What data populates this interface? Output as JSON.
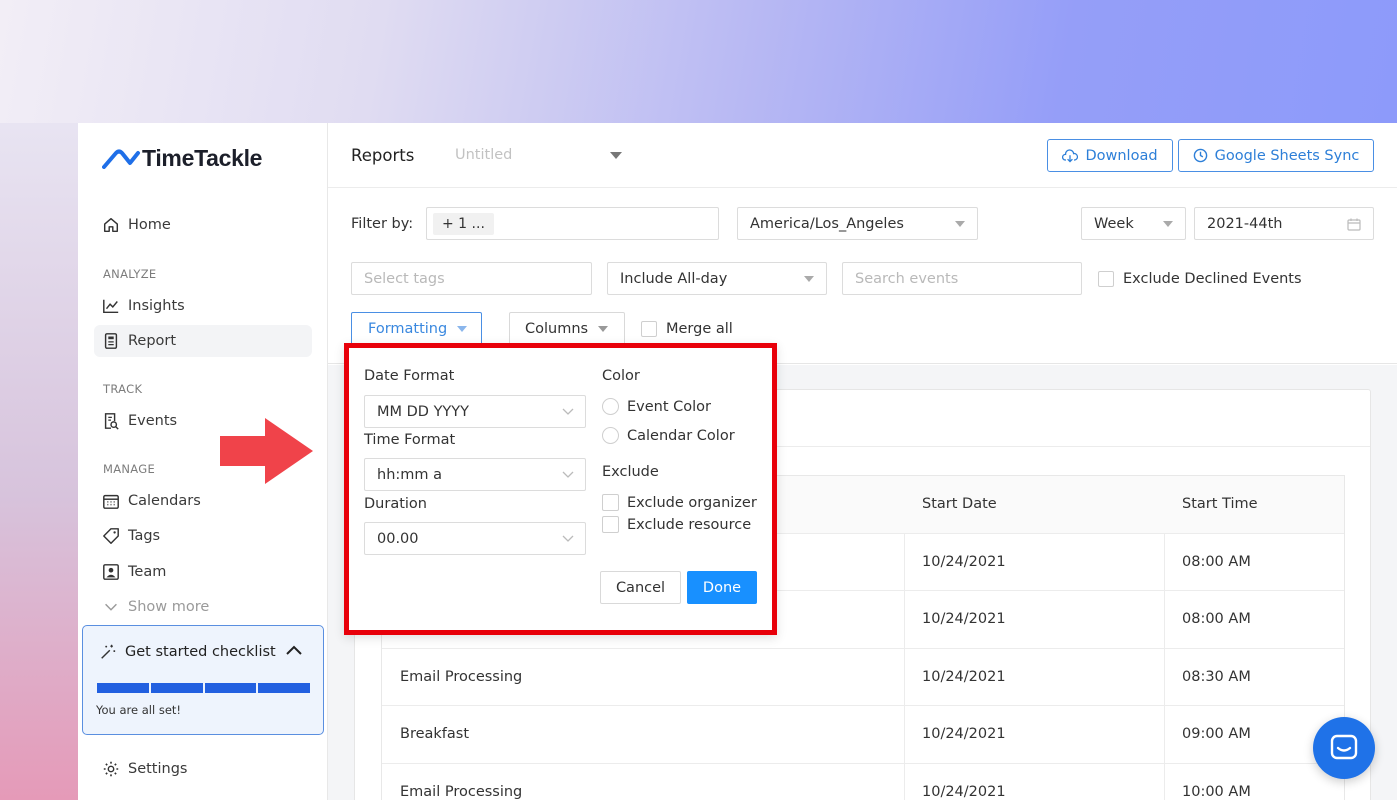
{
  "app": {
    "logo_text": "TimeTackle"
  },
  "sidebar": {
    "home": "Home",
    "section_analyze": "ANALYZE",
    "insights": "Insights",
    "report": "Report",
    "section_track": "TRACK",
    "events": "Events",
    "section_manage": "MANAGE",
    "calendars": "Calendars",
    "tags": "Tags",
    "team": "Team",
    "show_more": "Show more",
    "settings": "Settings"
  },
  "checklist": {
    "title": "Get started checklist",
    "message": "You are all set!",
    "progress_segments": 4,
    "progress_complete": 4
  },
  "header": {
    "title": "Reports",
    "report_name_placeholder": "Untitled",
    "download_label": "Download",
    "sheets_sync_label": "Google Sheets Sync"
  },
  "filters": {
    "filter_by_label": "Filter by:",
    "filter_chip": "+ 1 ...",
    "timezone": "America/Los_Angeles",
    "period": "Week",
    "period_value": "2021-44th",
    "tags_placeholder": "Select tags",
    "allday": "Include All-day",
    "search_placeholder": "Search events",
    "exclude_declined": "Exclude Declined Events",
    "formatting_label": "Formatting",
    "columns_label": "Columns",
    "merge_all": "Merge all"
  },
  "formatting_popup": {
    "date_format_label": "Date Format",
    "date_format_value": "MM DD YYYY",
    "time_format_label": "Time Format",
    "time_format_value": "hh:mm a",
    "duration_label": "Duration",
    "duration_value": "00.00",
    "color_label": "Color",
    "event_color": "Event Color",
    "calendar_color": "Calendar Color",
    "exclude_label": "Exclude",
    "exclude_organizer": "Exclude organizer",
    "exclude_resource": "Exclude resource",
    "cancel": "Cancel",
    "done": "Done"
  },
  "table": {
    "columns": [
      "",
      "Start Date",
      "Start Time"
    ],
    "rows": [
      [
        "",
        "10/24/2021",
        "08:00 AM"
      ],
      [
        "",
        "10/24/2021",
        "08:00 AM"
      ],
      [
        "Email Processing",
        "10/24/2021",
        "08:30 AM"
      ],
      [
        "Breakfast",
        "10/24/2021",
        "09:00 AM"
      ],
      [
        "Email Processing",
        "10/24/2021",
        "10:00 AM"
      ]
    ]
  },
  "colors": {
    "accent": "#1890ff",
    "highlight_border": "#e8000a",
    "arrow": "#f0434a"
  }
}
